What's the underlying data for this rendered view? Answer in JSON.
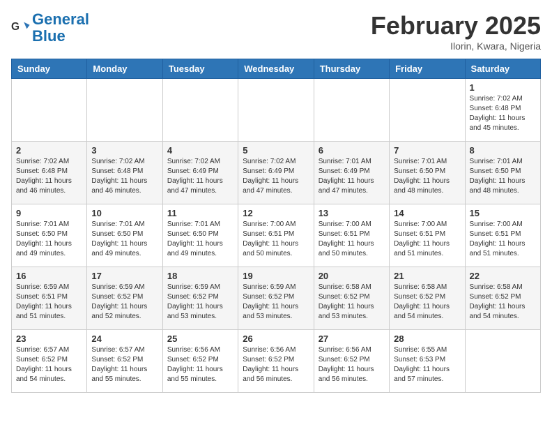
{
  "header": {
    "logo_line1": "General",
    "logo_line2": "Blue",
    "month_title": "February 2025",
    "location": "Ilorin, Kwara, Nigeria"
  },
  "weekdays": [
    "Sunday",
    "Monday",
    "Tuesday",
    "Wednesday",
    "Thursday",
    "Friday",
    "Saturday"
  ],
  "weeks": [
    [
      {
        "day": "",
        "info": ""
      },
      {
        "day": "",
        "info": ""
      },
      {
        "day": "",
        "info": ""
      },
      {
        "day": "",
        "info": ""
      },
      {
        "day": "",
        "info": ""
      },
      {
        "day": "",
        "info": ""
      },
      {
        "day": "1",
        "info": "Sunrise: 7:02 AM\nSunset: 6:48 PM\nDaylight: 11 hours\nand 45 minutes."
      }
    ],
    [
      {
        "day": "2",
        "info": "Sunrise: 7:02 AM\nSunset: 6:48 PM\nDaylight: 11 hours\nand 46 minutes."
      },
      {
        "day": "3",
        "info": "Sunrise: 7:02 AM\nSunset: 6:48 PM\nDaylight: 11 hours\nand 46 minutes."
      },
      {
        "day": "4",
        "info": "Sunrise: 7:02 AM\nSunset: 6:49 PM\nDaylight: 11 hours\nand 47 minutes."
      },
      {
        "day": "5",
        "info": "Sunrise: 7:02 AM\nSunset: 6:49 PM\nDaylight: 11 hours\nand 47 minutes."
      },
      {
        "day": "6",
        "info": "Sunrise: 7:01 AM\nSunset: 6:49 PM\nDaylight: 11 hours\nand 47 minutes."
      },
      {
        "day": "7",
        "info": "Sunrise: 7:01 AM\nSunset: 6:50 PM\nDaylight: 11 hours\nand 48 minutes."
      },
      {
        "day": "8",
        "info": "Sunrise: 7:01 AM\nSunset: 6:50 PM\nDaylight: 11 hours\nand 48 minutes."
      }
    ],
    [
      {
        "day": "9",
        "info": "Sunrise: 7:01 AM\nSunset: 6:50 PM\nDaylight: 11 hours\nand 49 minutes."
      },
      {
        "day": "10",
        "info": "Sunrise: 7:01 AM\nSunset: 6:50 PM\nDaylight: 11 hours\nand 49 minutes."
      },
      {
        "day": "11",
        "info": "Sunrise: 7:01 AM\nSunset: 6:50 PM\nDaylight: 11 hours\nand 49 minutes."
      },
      {
        "day": "12",
        "info": "Sunrise: 7:00 AM\nSunset: 6:51 PM\nDaylight: 11 hours\nand 50 minutes."
      },
      {
        "day": "13",
        "info": "Sunrise: 7:00 AM\nSunset: 6:51 PM\nDaylight: 11 hours\nand 50 minutes."
      },
      {
        "day": "14",
        "info": "Sunrise: 7:00 AM\nSunset: 6:51 PM\nDaylight: 11 hours\nand 51 minutes."
      },
      {
        "day": "15",
        "info": "Sunrise: 7:00 AM\nSunset: 6:51 PM\nDaylight: 11 hours\nand 51 minutes."
      }
    ],
    [
      {
        "day": "16",
        "info": "Sunrise: 6:59 AM\nSunset: 6:51 PM\nDaylight: 11 hours\nand 51 minutes."
      },
      {
        "day": "17",
        "info": "Sunrise: 6:59 AM\nSunset: 6:52 PM\nDaylight: 11 hours\nand 52 minutes."
      },
      {
        "day": "18",
        "info": "Sunrise: 6:59 AM\nSunset: 6:52 PM\nDaylight: 11 hours\nand 53 minutes."
      },
      {
        "day": "19",
        "info": "Sunrise: 6:59 AM\nSunset: 6:52 PM\nDaylight: 11 hours\nand 53 minutes."
      },
      {
        "day": "20",
        "info": "Sunrise: 6:58 AM\nSunset: 6:52 PM\nDaylight: 11 hours\nand 53 minutes."
      },
      {
        "day": "21",
        "info": "Sunrise: 6:58 AM\nSunset: 6:52 PM\nDaylight: 11 hours\nand 54 minutes."
      },
      {
        "day": "22",
        "info": "Sunrise: 6:58 AM\nSunset: 6:52 PM\nDaylight: 11 hours\nand 54 minutes."
      }
    ],
    [
      {
        "day": "23",
        "info": "Sunrise: 6:57 AM\nSunset: 6:52 PM\nDaylight: 11 hours\nand 54 minutes."
      },
      {
        "day": "24",
        "info": "Sunrise: 6:57 AM\nSunset: 6:52 PM\nDaylight: 11 hours\nand 55 minutes."
      },
      {
        "day": "25",
        "info": "Sunrise: 6:56 AM\nSunset: 6:52 PM\nDaylight: 11 hours\nand 55 minutes."
      },
      {
        "day": "26",
        "info": "Sunrise: 6:56 AM\nSunset: 6:52 PM\nDaylight: 11 hours\nand 56 minutes."
      },
      {
        "day": "27",
        "info": "Sunrise: 6:56 AM\nSunset: 6:52 PM\nDaylight: 11 hours\nand 56 minutes."
      },
      {
        "day": "28",
        "info": "Sunrise: 6:55 AM\nSunset: 6:53 PM\nDaylight: 11 hours\nand 57 minutes."
      },
      {
        "day": "",
        "info": ""
      }
    ]
  ]
}
